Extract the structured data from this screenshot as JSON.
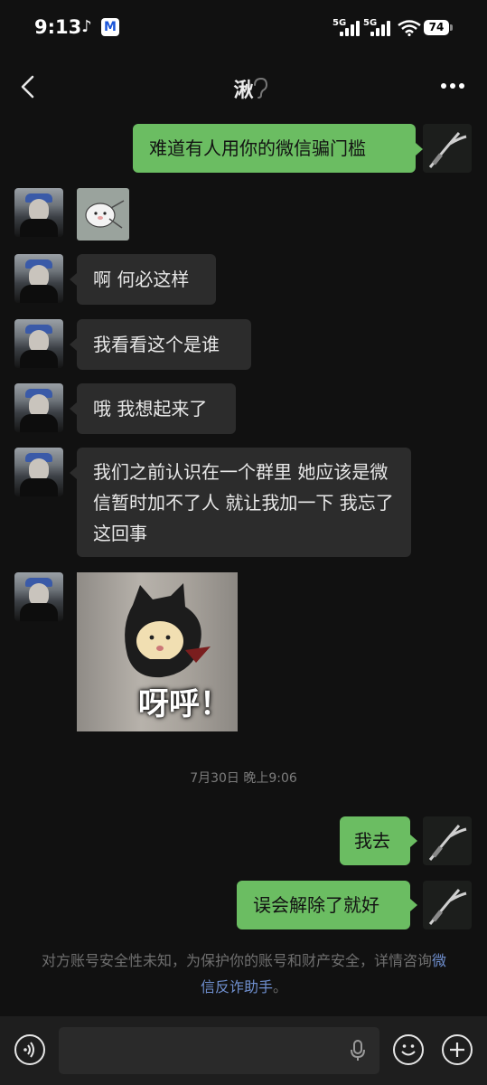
{
  "status_bar": {
    "time": "9:13",
    "net1": "5G",
    "net2": "5G",
    "battery": "74"
  },
  "header": {
    "title": "湫",
    "back_icon": "chevron-left-icon",
    "ear_icon": "ear-icon",
    "more_icon": "more-dots-icon"
  },
  "messages": [
    {
      "side": "me",
      "text": "难道有人用你的微信骗门槛"
    },
    {
      "side": "other",
      "kind": "sticker",
      "icon": "bunny-sticker-icon"
    },
    {
      "side": "other",
      "text": "啊 何必这样"
    },
    {
      "side": "other",
      "text": "我看看这个是谁"
    },
    {
      "side": "other",
      "text": "哦 我想起来了"
    },
    {
      "side": "other",
      "text": "我们之前认识在一个群里 她应该是微信暂时加不了人 就让我加一下 我忘了这回事"
    },
    {
      "side": "other",
      "kind": "sticker",
      "caption": "呀呼！"
    },
    {
      "side": "me",
      "text": "我去"
    },
    {
      "side": "me",
      "text": "误会解除了就好"
    }
  ],
  "timestamp": "7月30日 晚上9:06",
  "notice": {
    "before": "对方账号安全性未知，为保护你的账号和财产安全，详情咨询",
    "link": "微信反诈助手",
    "after": "。"
  },
  "input_bar": {
    "placeholder": "",
    "voice_icon": "voice-icon",
    "mic_icon": "mic-icon",
    "emoji_icon": "emoji-icon",
    "plus_icon": "plus-icon"
  },
  "colors": {
    "background": "#111111",
    "bubble_other": "#2c2c2c",
    "bubble_me": "#6bbd62",
    "link": "#6f8fcf"
  }
}
